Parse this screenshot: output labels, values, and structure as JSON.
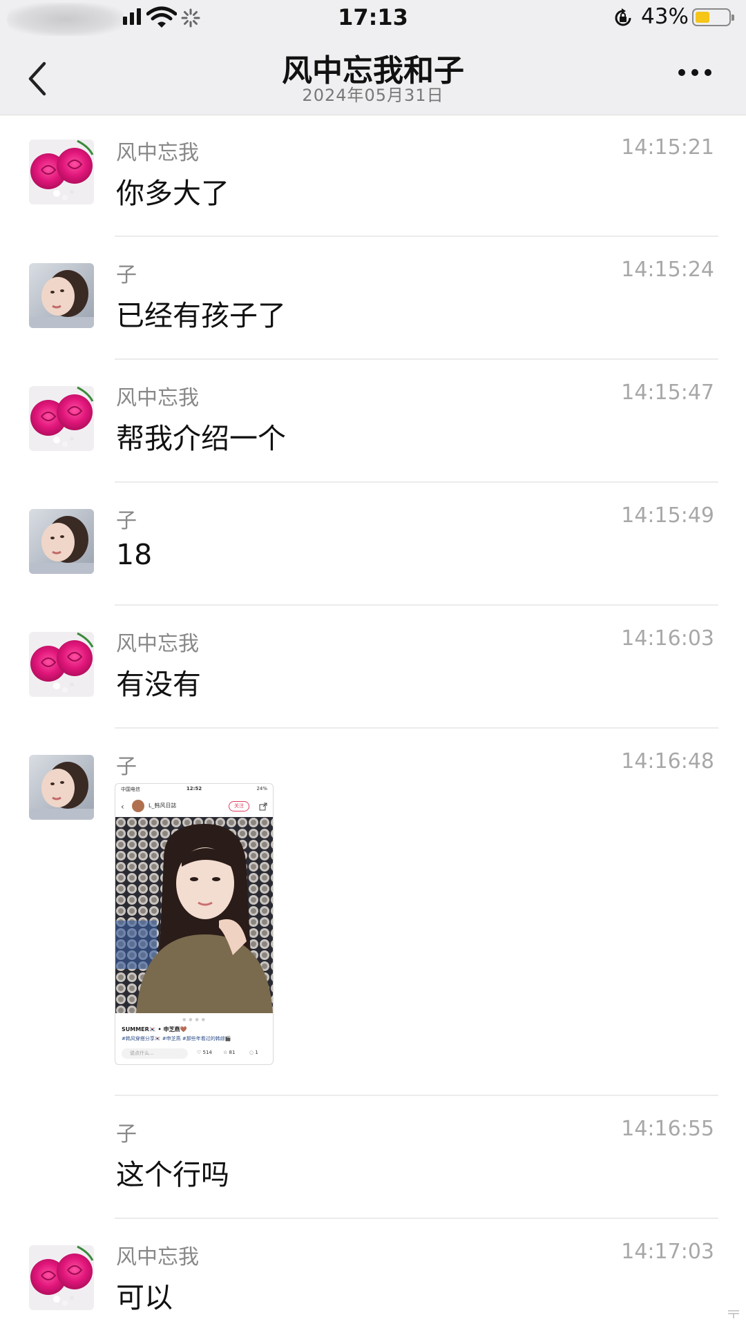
{
  "status_bar": {
    "time": "17:13",
    "battery_percent_text": "43%",
    "battery_level": 0.43,
    "battery_color": "#f5c518"
  },
  "nav": {
    "title": "风中忘我和子",
    "subtitle": "2024年05月31日",
    "back_icon": "chevron-left-icon",
    "more_icon": "ellipsis-icon"
  },
  "messages": [
    {
      "sender": "风中忘我",
      "time": "14:15:21",
      "text": "你多大了",
      "avatar": "rose-avatar"
    },
    {
      "sender": "子",
      "time": "14:15:24",
      "text": "已经有孩子了",
      "avatar": "girl-avatar"
    },
    {
      "sender": "风中忘我",
      "time": "14:15:47",
      "text": "帮我介绍一个",
      "avatar": "rose-avatar"
    },
    {
      "sender": "子",
      "time": "14:15:49",
      "text": "18",
      "avatar": "girl-avatar"
    },
    {
      "sender": "风中忘我",
      "time": "14:16:03",
      "text": "有没有",
      "avatar": "rose-avatar"
    },
    {
      "sender": "子",
      "time": "14:16:48",
      "avatar": "girl-avatar",
      "image": {
        "status_left": "中国电信",
        "status_time": "12:52",
        "status_right": "24%",
        "account_name": "L_韩风日誌",
        "follow_label": "关注",
        "caption": "SUMMER🇰🇷 • 申芝燕🤎",
        "tags": "#韩风穿搭分享🇰🇷  #申芝燕  #那些年看过的韩综🎬",
        "comment_placeholder": "说点什么...",
        "likes": "514",
        "stars": "81",
        "comments": "1"
      }
    },
    {
      "sender": "子",
      "time": "14:16:55",
      "text": "这个行吗"
    },
    {
      "sender": "风中忘我",
      "time": "14:17:03",
      "text": "可以",
      "avatar": "rose-avatar"
    }
  ]
}
